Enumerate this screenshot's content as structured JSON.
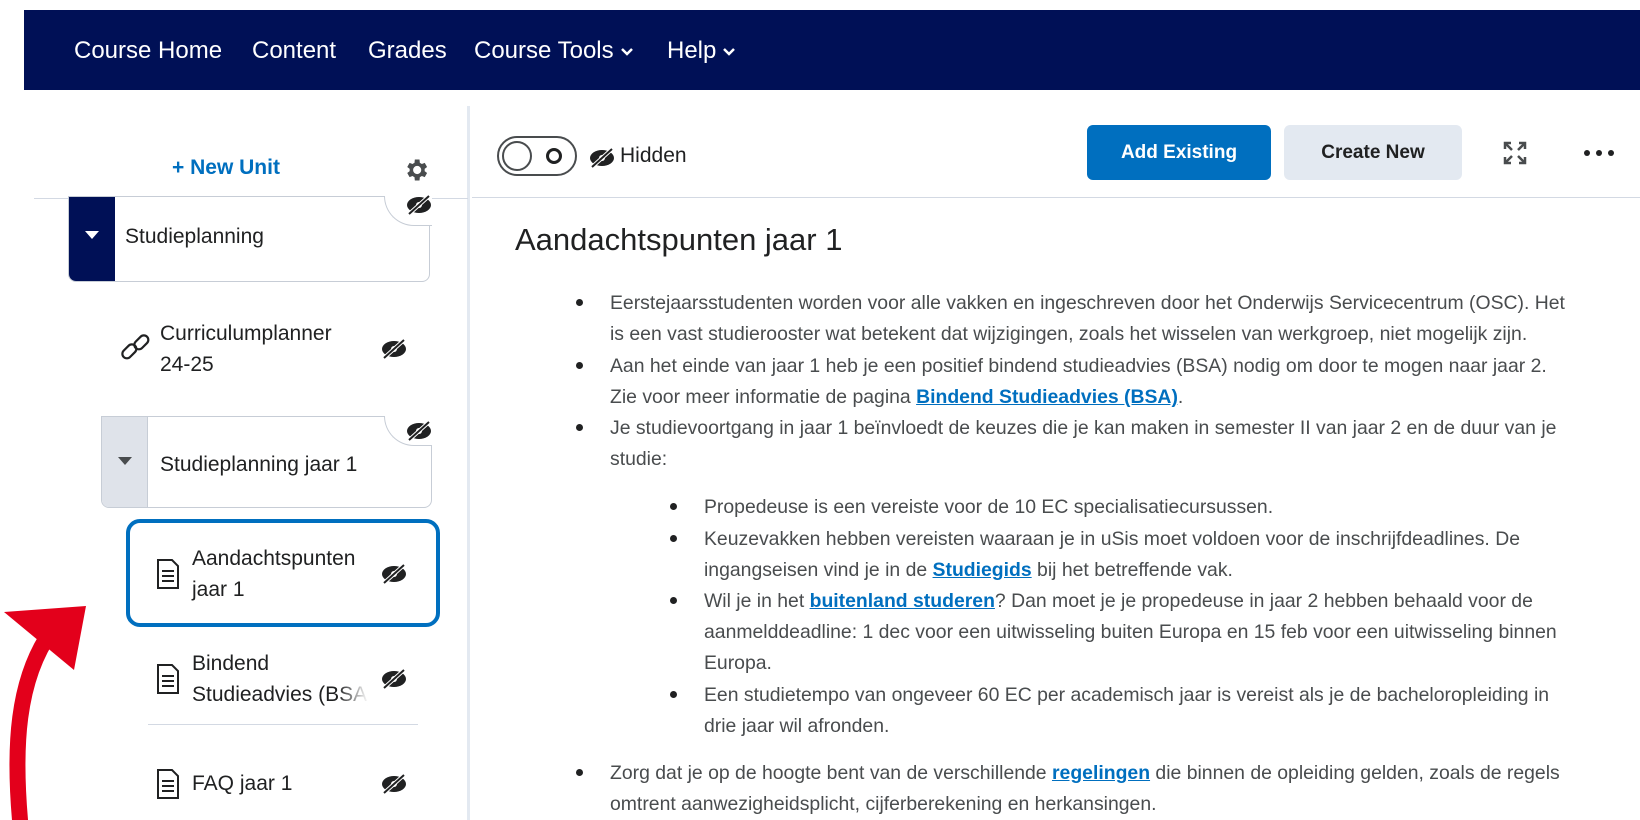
{
  "nav": {
    "course_home": "Course Home",
    "content": "Content",
    "grades": "Grades",
    "course_tools": "Course Tools",
    "help": "Help"
  },
  "sidebar": {
    "new_unit": "+ New Unit",
    "unit_title": "Studieplanning",
    "items": [
      {
        "label_line1": "Curriculumplanner",
        "label_line2": "24-25",
        "icon": "link-icon"
      },
      {
        "label": "Studieplanning jaar 1"
      },
      {
        "label_line1": "Aandachtspunten",
        "label_line2": "jaar 1",
        "icon": "document-icon",
        "selected": true
      },
      {
        "label_line1": "Bindend",
        "label_line2": "Studieadvies (BSA)",
        "icon": "document-icon"
      },
      {
        "label": "FAQ jaar 1",
        "icon": "document-icon"
      }
    ]
  },
  "toolbar": {
    "visibility_label": "Hidden",
    "add_existing": "Add Existing",
    "create_new": "Create New"
  },
  "content": {
    "title": "Aandachtspunten jaar 1",
    "b1_l1": "Eerstejaarsstudenten worden voor alle vakken en ingeschreven door het Onderwijs Servicecentrum (OSC). Het",
    "b1_l2": "is een vast studierooster wat betekent dat wijzigingen, zoals het wisselen van werkgroep, niet mogelijk zijn.",
    "b2_l1": "Aan het einde van jaar 1 heb je een positief bindend studieadvies (BSA) nodig om door te mogen naar jaar 2.",
    "b2_l2_pre": "Zie voor meer informatie de pagina ",
    "b2_link": "Bindend Studieadvies (BSA)",
    "b2_l2_post": ".",
    "b3_l1": "Je studievoortgang in jaar 1 beïnvloedt de keuzes die je kan maken in semester II van jaar 2 en de duur van je",
    "b3_l2": "studie:",
    "s1_l1": "Propedeuse is een vereiste voor de 10 EC specialisatiecursussen.",
    "s2_l1": "Keuzevakken hebben vereisten waaraan je in uSis moet voldoen voor de inschrijfdeadlines. De",
    "s2_l2_pre": "ingangseisen vind je in de ",
    "s2_link": "Studiegids",
    "s2_l2_post": " bij het betreffende vak.",
    "s3_l1_pre": "Wil je in het ",
    "s3_link": "buitenland studeren",
    "s3_l1_post": "? Dan moet je je propedeuse in jaar 2 hebben behaald voor de",
    "s3_l2": "aanmelddeadline: 1 dec voor een uitwisseling buiten Europa en 15 feb voor een uitwisseling binnen",
    "s3_l3": "Europa.",
    "s4_l1": "Een studietempo van ongeveer 60 EC per academisch jaar is vereist als je de bacheloropleiding in",
    "s4_l2": "drie jaar wil afronden.",
    "b4_l1_pre": "Zorg dat je op de hoogte bent van de verschillende ",
    "b4_link": "regelingen",
    "b4_l1_post": " die binnen de opleiding gelden, zoals de regels",
    "b4_l2": "omtrent aanwezigheidsplicht, cijferberekening en herkansingen."
  },
  "colors": {
    "navbar": "#001056",
    "accent": "#006fbf",
    "annotation": "#e3001b"
  }
}
